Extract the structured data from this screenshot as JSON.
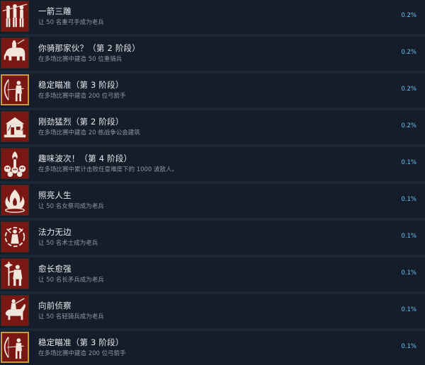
{
  "achievements": [
    {
      "title": "一箭三雕",
      "desc": "让 50 名重弓手成为老兵",
      "pct": "0.2%",
      "icon": "archers-trio-icon"
    },
    {
      "title": "你骑那家伙？（第 2 阶段）",
      "desc": "在多场比赛中建造 50 位重骑兵",
      "pct": "0.2%",
      "icon": "war-elephant-icon"
    },
    {
      "title": "稳定瞄准（第 3 阶段）",
      "desc": "在多场比赛中建造 200 位弓箭手",
      "pct": "0.2%",
      "icon": "archer-icon"
    },
    {
      "title": "刚劲猛烈（第 2 阶段）",
      "desc": "在多场比赛中建造 20 栋战争公会建筑",
      "pct": "0.2%",
      "icon": "war-guild-icon"
    },
    {
      "title": "趣味波次！（第 4 阶段）",
      "desc": "在多场比赛中累计击败任意难度下的 1000 波敌人。",
      "pct": "0.1%",
      "icon": "skull-torch-icon"
    },
    {
      "title": "照亮人生",
      "desc": "让 50 名女祭司成为老兵",
      "pct": "0.1%",
      "icon": "flame-icon"
    },
    {
      "title": "法力无边",
      "desc": "让 50 名术士成为老兵",
      "pct": "0.1%",
      "icon": "magic-circle-icon"
    },
    {
      "title": "愈长愈强",
      "desc": "让 50 名长矛兵成为老兵",
      "pct": "0.1%",
      "icon": "halberdier-icon"
    },
    {
      "title": "向前侦察",
      "desc": "让 50 名轻骑兵成为老兵",
      "pct": "0.1%",
      "icon": "light-cavalry-icon"
    },
    {
      "title": "稳定瞄准（第 3 阶段）",
      "desc": "在多场比赛中建造 200 位弓箭手",
      "pct": "0.1%",
      "icon": "archer-icon"
    }
  ]
}
